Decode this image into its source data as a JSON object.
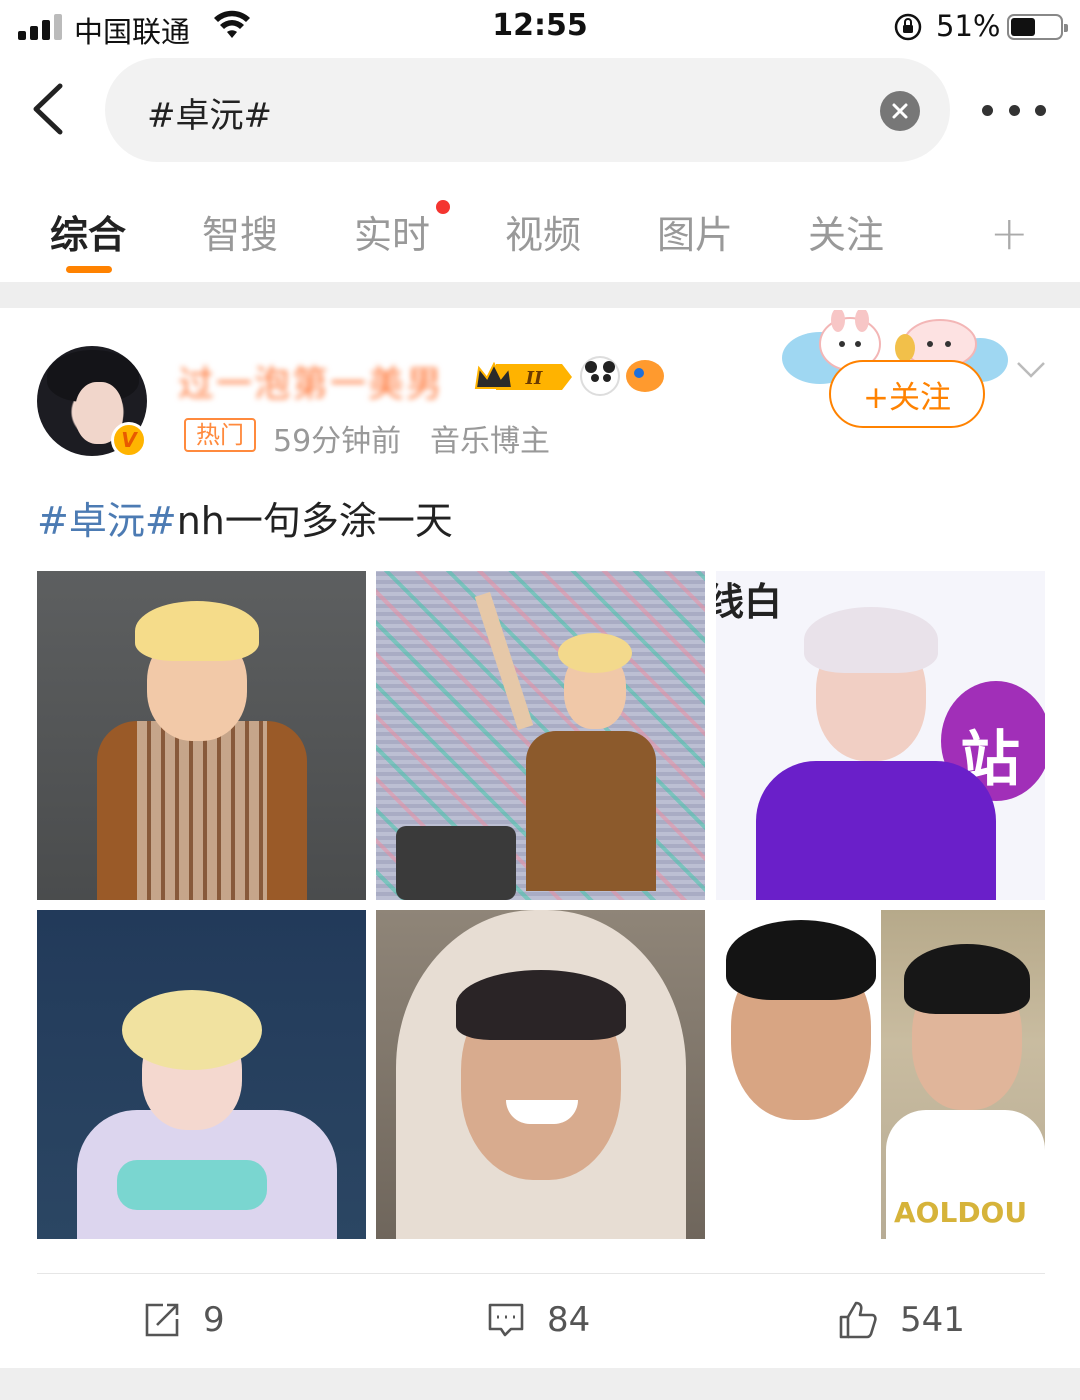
{
  "status_bar": {
    "carrier": "中国联通",
    "time": "12:55",
    "battery_percent": "51%",
    "battery_level": 0.51
  },
  "search": {
    "query": "#卓沅#"
  },
  "tabs": [
    {
      "label": "综合",
      "active": true
    },
    {
      "label": "智搜",
      "active": false
    },
    {
      "label": "实时",
      "active": false,
      "dot": true
    },
    {
      "label": "视频",
      "active": false
    },
    {
      "label": "图片",
      "active": false
    },
    {
      "label": "关注",
      "active": false
    }
  ],
  "tab_add": "+",
  "post": {
    "username": "过一泡第一美男",
    "level_badge": "II",
    "hot_tag": "热门",
    "time": "59分钟前",
    "source": "音乐博主",
    "follow_label": "+关注",
    "topic": "#卓沅#",
    "text": "nh一句多涂一天",
    "image_labels": {
      "sign": "站",
      "sign_top": "线白",
      "shirt": "AOLDOU"
    },
    "reposts": "9",
    "comments": "84",
    "likes": "541"
  },
  "colors": {
    "accent": "#ff8200",
    "topic": "#4c7bb3",
    "red_dot": "#f43530"
  }
}
